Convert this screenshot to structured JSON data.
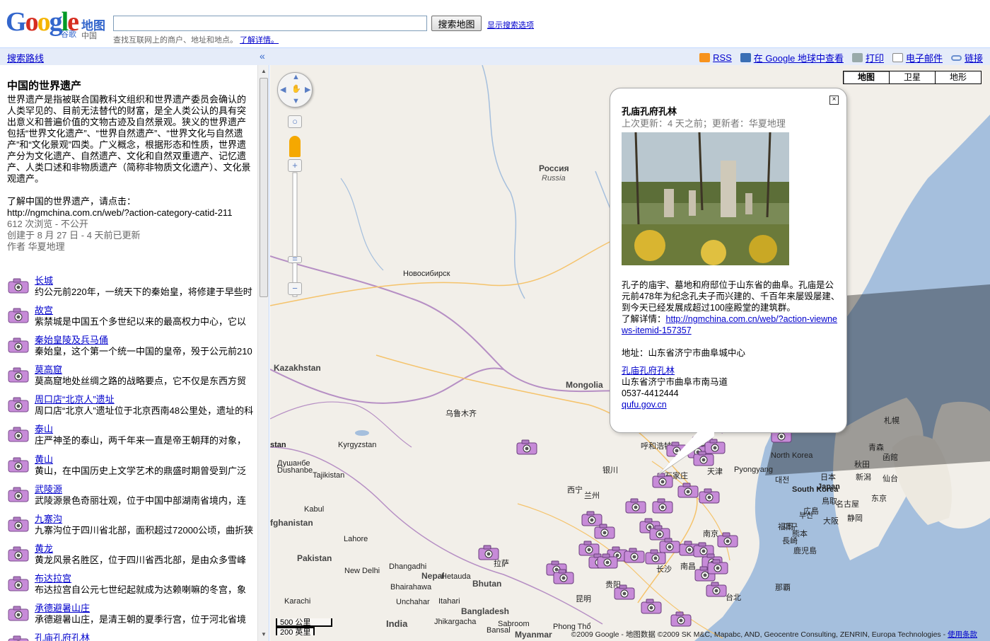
{
  "header": {
    "logo_text": "Google",
    "logo_sub": "谷歌",
    "logo_maps": "地图",
    "logo_region": "中国",
    "search_value": "",
    "search_button": "搜索地图",
    "search_options": "显示搜索选项",
    "hint_text": "查找互联网上的商户、地址和地点。",
    "hint_link": "了解详情。"
  },
  "toolbar": {
    "route_link": "搜索路线",
    "collapse": "«",
    "rss": "RSS",
    "earth": "在 Google 地球中查看",
    "print": "打印",
    "email": "电子邮件",
    "link": "链接"
  },
  "panel": {
    "title": "中国的世界遗产",
    "description": "世界遗产是指被联合国教科文组织和世界遗产委员会确认的人类罕见的、目前无法替代的财富，是全人类公认的具有突出意义和普遍价值的文物古迹及自然景观。狭义的世界遗产包括“世界文化遗产”、“世界自然遗产”、“世界文化与自然遗产”和“文化景观”四类。广义概念，根据形态和性质，世界遗产分为文化遗产、自然遗产、文化和自然双重遗产、记忆遗产、人类口述和非物质遗产（简称非物质文化遗产）、文化景观遗产。",
    "learn_more": "了解中国的世界遗产，请点击：",
    "learn_url": "http://ngmchina.com.cn/web/?action-category-catid-211",
    "views": "612 次浏览 - 不公开",
    "created": "创建于 8 月 27 日 - 4 天前已更新",
    "author": "作者 华夏地理",
    "items": [
      {
        "title": "长城",
        "desc": "约公元前220年，一统天下的秦始皇，将修建于早些时"
      },
      {
        "title": "故宫",
        "desc": "紫禁城是中国五个多世纪以来的最高权力中心，它以"
      },
      {
        "title": "秦始皇陵及兵马俑",
        "desc": "秦始皇，这个第一个统一中国的皇帝，殁于公元前210"
      },
      {
        "title": "莫高窟",
        "desc": "莫高窟地处丝绸之路的战略要点，它不仅是东西方贸"
      },
      {
        "title": "周口店“北京人”遗址",
        "desc": "周口店“北京人”遗址位于北京西南48公里处，遗址的科"
      },
      {
        "title": "泰山",
        "desc": "庄严神圣的泰山，两千年来一直是帝王朝拜的对象，"
      },
      {
        "title": "黄山",
        "desc": "黄山，在中国历史上文学艺术的鼎盛时期曾受到广泛"
      },
      {
        "title": "武陵源",
        "desc": "武陵源景色奇丽壮观，位于中国中部湖南省境内，连"
      },
      {
        "title": "九寨沟",
        "desc": "九寨沟位于四川省北部，面积超过72000公顷，曲折狭"
      },
      {
        "title": "黄龙",
        "desc": "黄龙风景名胜区，位于四川省西北部，是由众多雪峰"
      },
      {
        "title": "布达拉宫",
        "desc": "布达拉宫自公元七世纪起就成为达赖喇嘛的冬宫，象"
      },
      {
        "title": "承德避暑山庄",
        "desc": "承德避暑山庄，是清王朝的夏季行宫，位于河北省境"
      },
      {
        "title": "孔庙孔府孔林",
        "desc": ""
      }
    ]
  },
  "map": {
    "types": [
      "地图",
      "卫星",
      "地形"
    ],
    "labels": {
      "russia": "Россия",
      "russia_en": "Russia",
      "novosibirsk": "Новосибирск",
      "kazakhstan": "Kazakhstan",
      "mongolia": "Mongolia",
      "urumqi": "乌鲁木齐",
      "kyrgyzstan": "Kyrgyzstan",
      "dushanbe": "Душанбе",
      "dushanbe_en": "Dushanbe",
      "tajikistan": "Tajikistan",
      "kabul": "Kabul",
      "afghanistan": "fghanistan",
      "lahore": "Lahore",
      "pakistan": "Pakistan",
      "new_delhi": "New Delhi",
      "nepal": "Nepal",
      "bhutan": "Bhutan",
      "bangladesh": "Bangladesh",
      "india": "India",
      "karachi": "Karachi",
      "myanmar": "Myanmar",
      "lhasa": "拉萨",
      "xining": "西宁",
      "lanzhou": "兰州",
      "yinchuan": "银川",
      "huhehaote": "呼和浩特",
      "shijiazhuang": "石家庄",
      "tianjin": "天津",
      "pyongyang": "Pyongyang",
      "north_korea": "North Korea",
      "south_korea": "South Korea",
      "japan": "Japan",
      "japan_cn": "日本",
      "tokyo": "东京",
      "kunming": "昆明",
      "guiyang": "贵阳",
      "changsha": "长沙",
      "nanchang": "南昌",
      "nanjing": "南京",
      "taibei": "台北",
      "naba": "那覇",
      "aomori": "青森",
      "akita": "秋田",
      "sendai": "仙台",
      "sapporo": "札幌",
      "niigata": "新潟",
      "osaka": "大阪",
      "nagoya": "名古屋",
      "hiroshima": "広島",
      "fukuoka": "福岡",
      "kumamoto": "熊本",
      "kagoshima": "鹿児島",
      "nagasaki": "長崎",
      "daegu": "대구",
      "busan": "부산",
      "daejeon": "대전",
      "hakodate": "函館",
      "shizuoka": "静岡",
      "tottori": "鳥取",
      "sabroom": "Sabroom",
      "phong_tho": "Phong Thổ",
      "dhangadhi": "Dhangadhi",
      "hetauda": "Hetauda",
      "itahari": "Itahari",
      "bhairahawa": "Bhairahawa",
      "unchahar": "Unchahar",
      "jhikargacha": "Jhikargacha",
      "bansal": "Bansal"
    },
    "scale_km": "500 公里",
    "scale_mi": "200 英里",
    "copyright": "©2009 Google - 地图数据 ©2009 SK M&C, Mapabc, AND, Geocentre Consulting, ZENRIN, Europa Technologies - ",
    "terms": "使用条款"
  },
  "infowindow": {
    "close": "×",
    "title": "孔庙孔府孔林",
    "updated": "上次更新：4 天之前；更新者：华夏地理",
    "body": "孔子的庙宇、墓地和府邸位于山东省的曲阜。孔庙是公元前478年为纪念孔夫子而兴建的、千百年来屡毁屡建、到今天已经发展成超过100座殿堂的建筑群。",
    "learn": "了解详情：",
    "learn_url": "http://ngmchina.com.cn/web/?action-viewnews-itemid-157357",
    "address": "地址：山东省济宁市曲阜城中心",
    "place_link": "孔庙孔府孔林",
    "place_addr": "山东省济宁市曲阜市南马道",
    "phone": "0537-4412444",
    "website": "qufu.gov.cn"
  },
  "colors": {
    "toolbar_bg": "#e5ecf9",
    "link": "#0000cc",
    "land": "#f2efe9",
    "water": "#a5bfdd",
    "marker": "#c78bd8"
  }
}
